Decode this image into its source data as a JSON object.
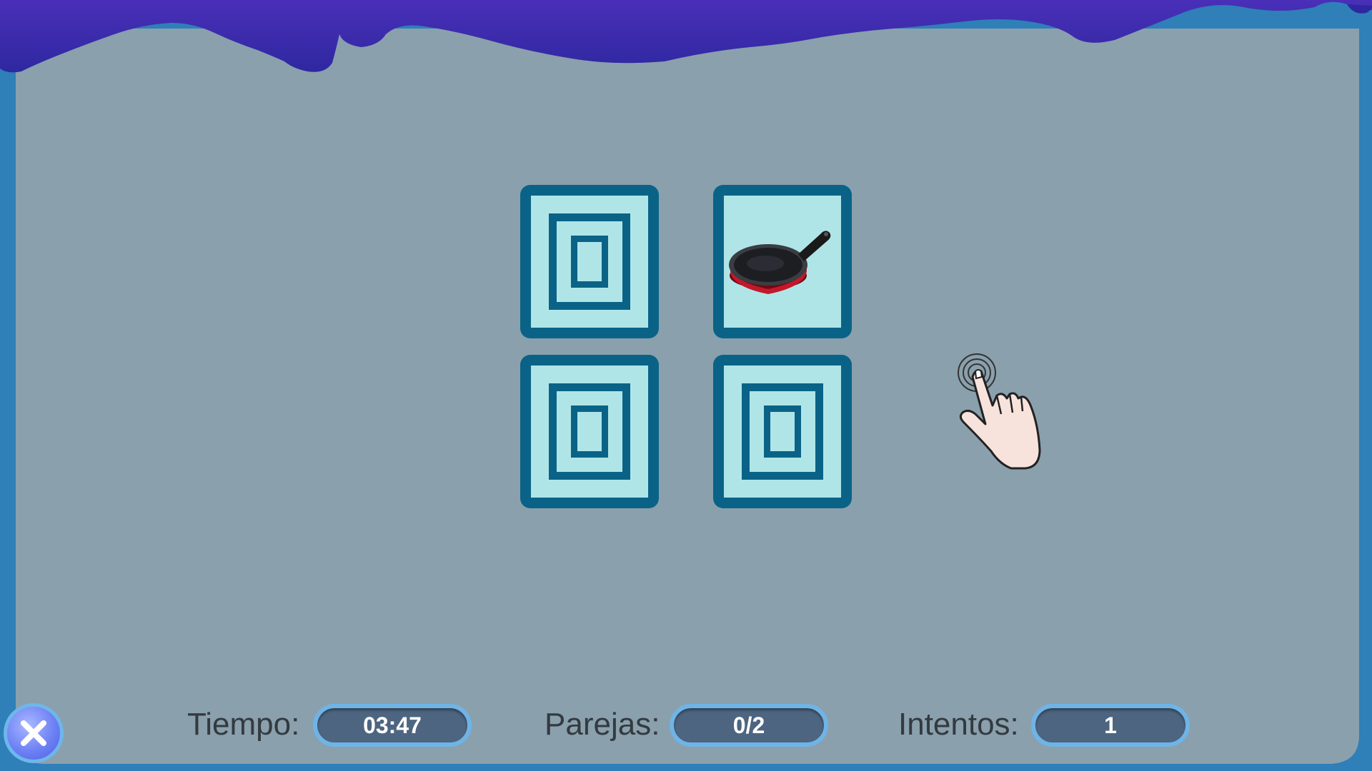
{
  "colors": {
    "frame_blue": "#2f7fb8",
    "board_gray": "#8aa0ad",
    "goo_purple": "#3b2aa8",
    "card_face": "#b0e5e8",
    "card_border": "#0a6387",
    "pill_fill": "#4d6580",
    "pill_border": "#6fb4e6"
  },
  "cards": [
    {
      "state": "face-down"
    },
    {
      "state": "face-up",
      "image_icon": "frying-pan-icon"
    },
    {
      "state": "face-down"
    },
    {
      "state": "face-down"
    }
  ],
  "hint": {
    "icon": "tap-hand-icon"
  },
  "stats": {
    "time_label": "Tiempo:",
    "time_value": "03:47",
    "pairs_label": "Parejas:",
    "pairs_value": "0/2",
    "attempts_label": "Intentos:",
    "attempts_value": "1"
  },
  "close_button": {
    "icon": "close-icon"
  }
}
